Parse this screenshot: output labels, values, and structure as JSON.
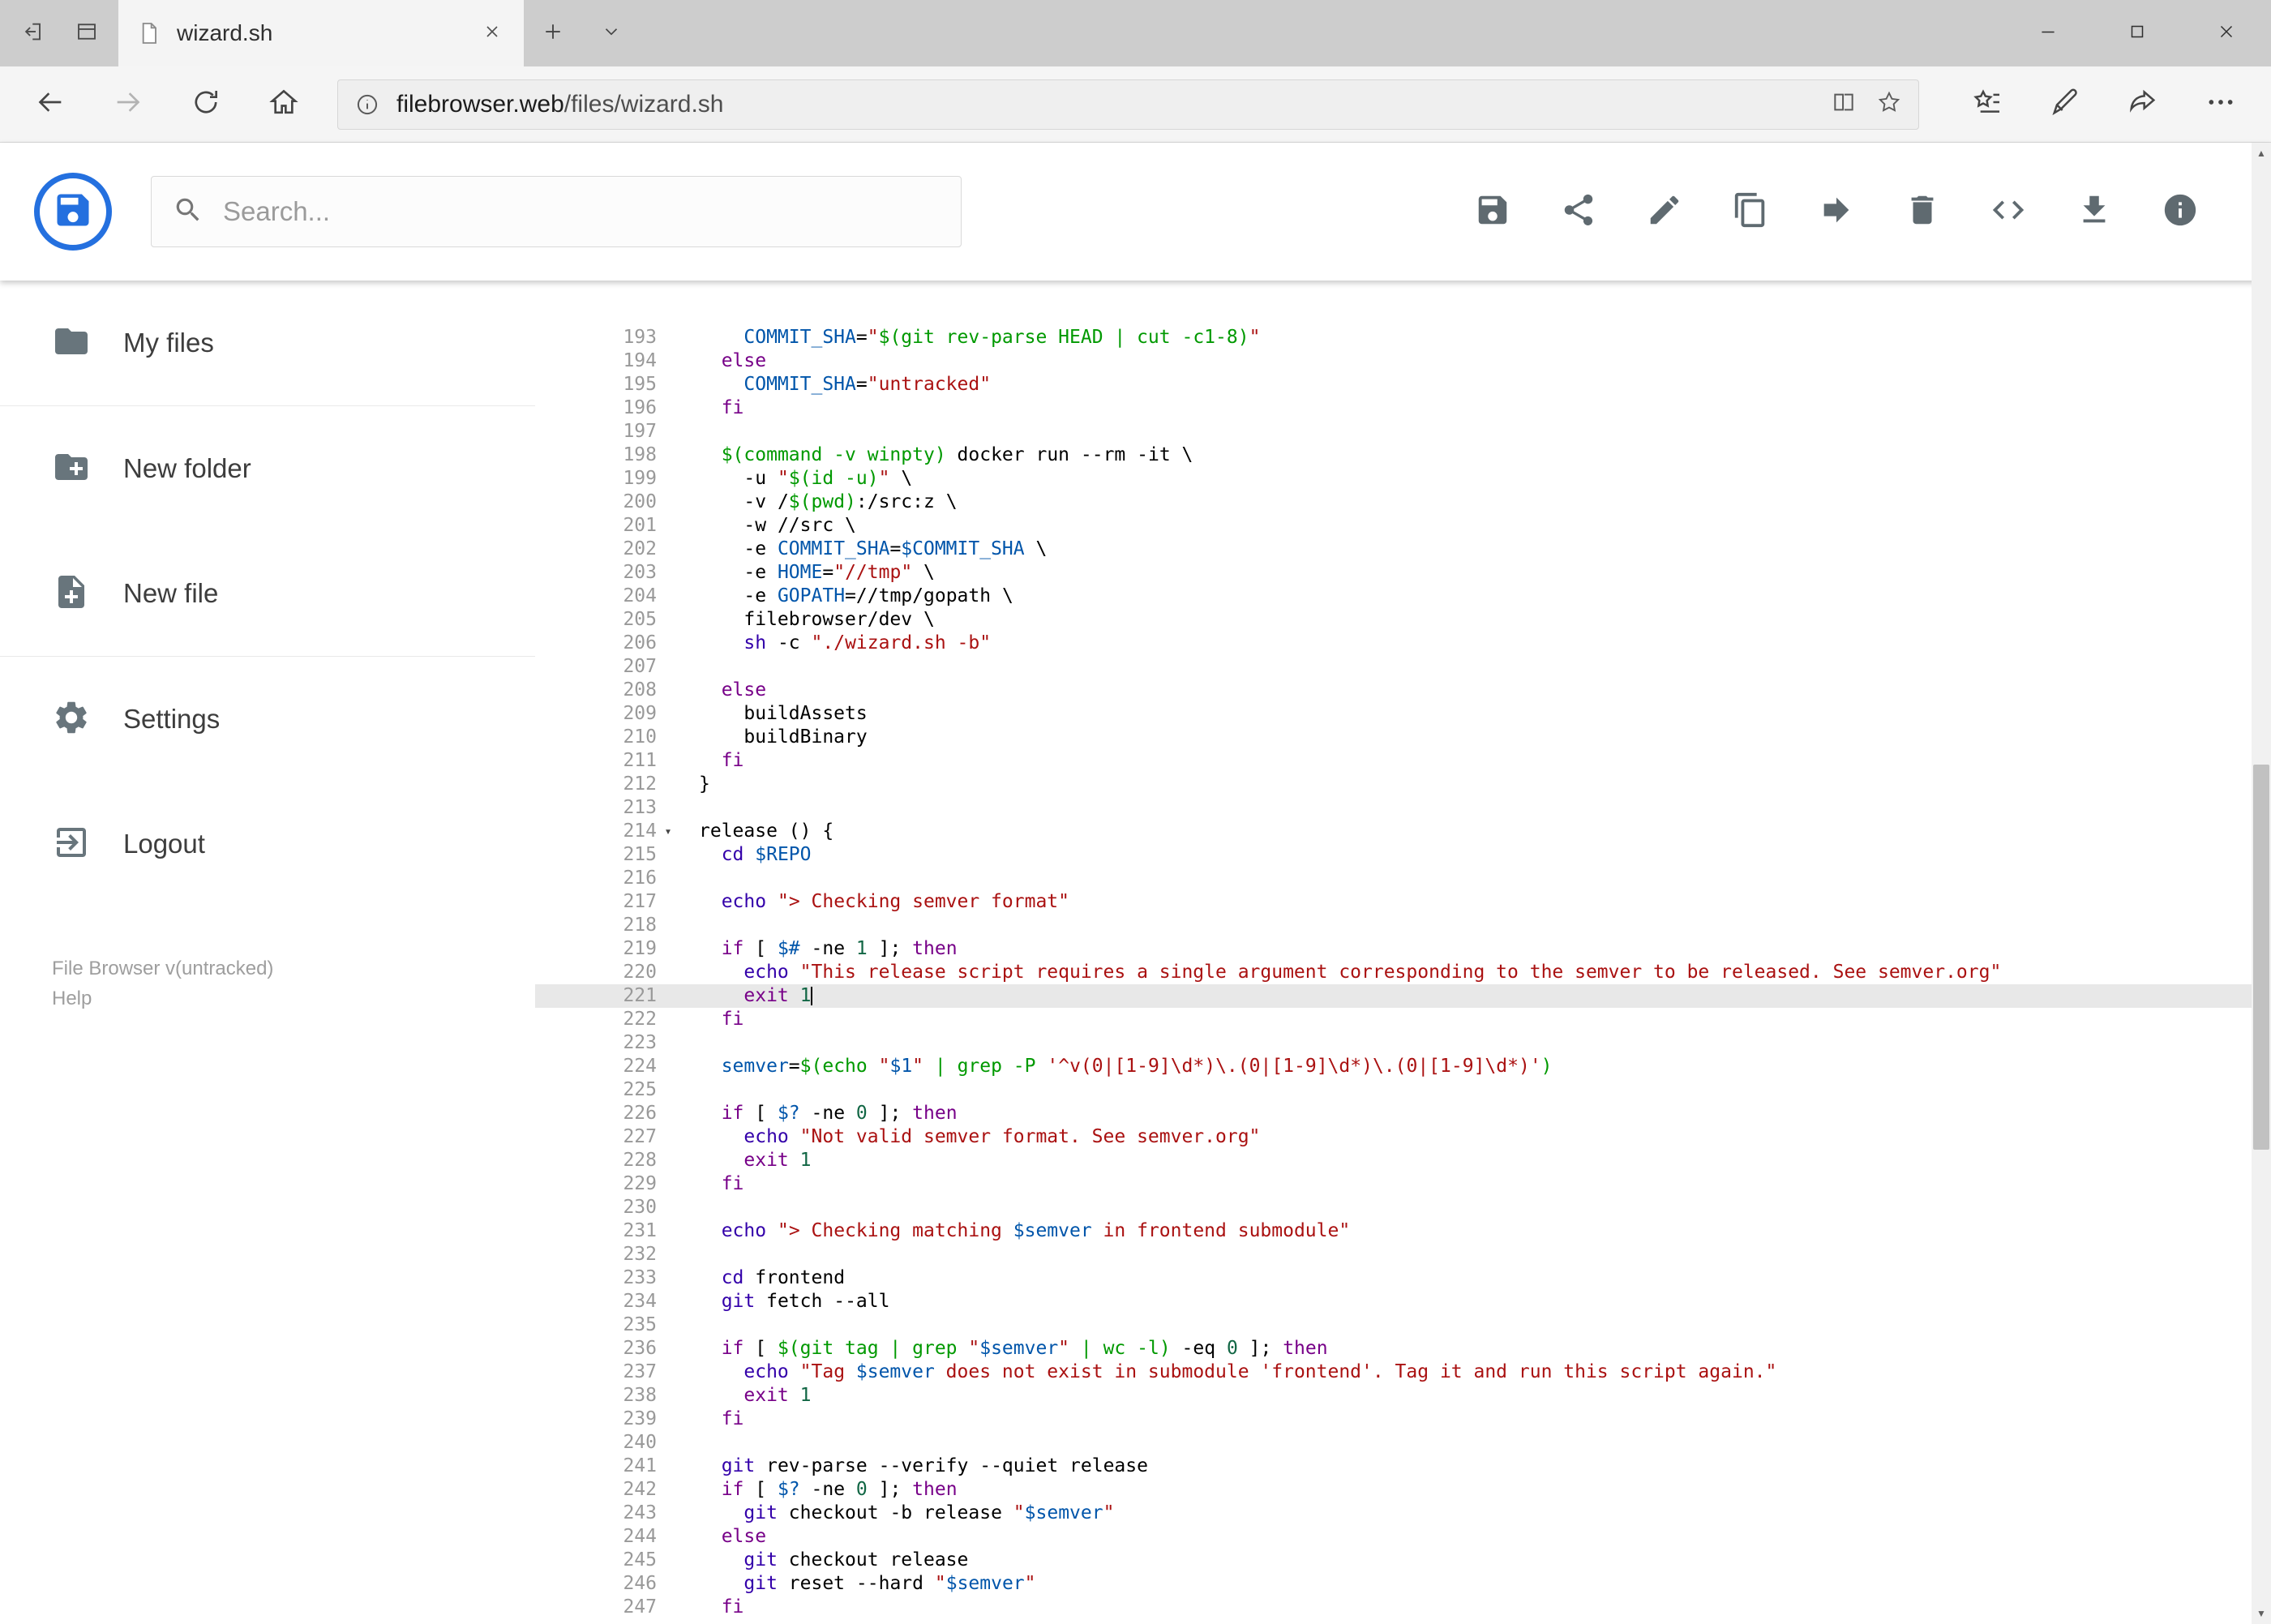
{
  "browser": {
    "tab_title": "wizard.sh",
    "url_domain": "filebrowser.web",
    "url_path": "/files/wizard.sh",
    "tab_strip_icons": [
      "set-tabs-aside",
      "tabs-preview",
      "new-tab",
      "tab-list-chevron"
    ],
    "window_controls": [
      "minimize",
      "maximize",
      "close"
    ],
    "nav_icons": [
      "back",
      "forward",
      "refresh",
      "home"
    ],
    "address_icons": [
      "site-info",
      "reading-view",
      "favorite-star"
    ],
    "action_icons": [
      "hub-favorites",
      "web-note-pen",
      "share",
      "more"
    ]
  },
  "app": {
    "search_placeholder": "Search...",
    "toolbar_icons": [
      "save",
      "share",
      "edit",
      "copy",
      "move",
      "delete",
      "code",
      "download",
      "info"
    ],
    "sidebar": {
      "items": [
        {
          "label": "My files",
          "icon": "folder-icon"
        },
        {
          "label": "New folder",
          "icon": "new-folder-icon"
        },
        {
          "label": "New file",
          "icon": "new-file-icon"
        },
        {
          "label": "Settings",
          "icon": "settings-icon"
        },
        {
          "label": "Logout",
          "icon": "logout-icon"
        }
      ],
      "footer_version": "File Browser v(untracked)",
      "footer_help": "Help"
    }
  },
  "colors": {
    "logo_blue": "#2470df",
    "active_line_bg": "#e8e8e8",
    "chrome_icon_gray": "#4a4a4a",
    "app_icon_gray": "#5f6a70"
  },
  "editor": {
    "first_line_number": 193,
    "active_line": 221,
    "cursor": {
      "line": 221,
      "col": 10
    },
    "fold_open_lines": [
      214
    ],
    "syntax_colors": {
      "keyword": "#770088",
      "builtin": "#3300aa",
      "string": "#aa1111",
      "def": "#0055aa",
      "quote": "#009900",
      "number": "#116644",
      "atom": "#221199"
    },
    "lines": [
      "    COMMIT_SHA=\"$(git rev-parse HEAD | cut -c1-8)\"",
      "  else",
      "    COMMIT_SHA=\"untracked\"",
      "  fi",
      "",
      "  $(command -v winpty) docker run --rm -it \\",
      "    -u \"$(id -u)\" \\",
      "    -v /$(pwd):/src:z \\",
      "    -w //src \\",
      "    -e COMMIT_SHA=$COMMIT_SHA \\",
      "    -e HOME=\"//tmp\" \\",
      "    -e GOPATH=//tmp/gopath \\",
      "    filebrowser/dev \\",
      "    sh -c \"./wizard.sh -b\"",
      "",
      "  else",
      "    buildAssets",
      "    buildBinary",
      "  fi",
      "}",
      "",
      "release () {",
      "  cd $REPO",
      "",
      "  echo \"> Checking semver format\"",
      "",
      "  if [ $# -ne 1 ]; then",
      "    echo \"This release script requires a single argument corresponding to the semver to be released. See semver.org\"",
      "    exit 1",
      "  fi",
      "",
      "  semver=$(echo \"$1\" | grep -P '^v(0|[1-9]\\d*)\\.(0|[1-9]\\d*)\\.(0|[1-9]\\d*)')",
      "",
      "  if [ $? -ne 0 ]; then",
      "    echo \"Not valid semver format. See semver.org\"",
      "    exit 1",
      "  fi",
      "",
      "  echo \"> Checking matching $semver in frontend submodule\"",
      "",
      "  cd frontend",
      "  git fetch --all",
      "",
      "  if [ $(git tag | grep \"$semver\" | wc -l) -eq 0 ]; then",
      "    echo \"Tag $semver does not exist in submodule 'frontend'. Tag it and run this script again.\"",
      "    exit 1",
      "  fi",
      "",
      "  git rev-parse --verify --quiet release",
      "  if [ $? -ne 0 ]; then",
      "    git checkout -b release \"$semver\"",
      "  else",
      "    git checkout release",
      "    git reset --hard \"$semver\"",
      "  fi"
    ]
  }
}
